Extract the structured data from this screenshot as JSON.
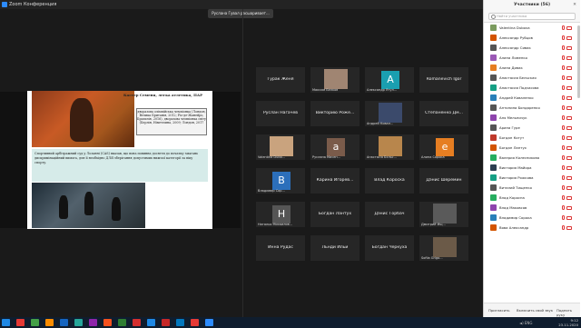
{
  "window": {
    "title": "Zoom Конференция",
    "share_banner": "Руслана Гувал расшаривает..."
  },
  "slide": {
    "header": "Кастер Семеня, легка атлетика, ПАР",
    "box1": "дворазова олімпійська чемпіонка (Лондон, Велика Британія, 2012; Ріо-де-Жанейро, Бразилія, 2016), дворазова чемпіонка світу (Берлін, Німеччина, 2009; Лондон, 2017",
    "box2": "Спортивний арбітражний суд у Лозанні (CAS) вказав, що вона повинна досягти до початку змагань дискримінаційний вимога, для її необхідно ДЛЯ зберігання допустимих нижчої категорії за віку спорту."
  },
  "tiles": [
    {
      "name": "Гурак Женя",
      "cap": "",
      "avatar": null
    },
    {
      "name": "",
      "cap": "Максим Белков",
      "avatar": "photo"
    },
    {
      "name": "",
      "cap": "Александр Ятул...",
      "avatar": "A",
      "color": "#1a9fb0"
    },
    {
      "name": "Romanevich Igor",
      "cap": "",
      "avatar": null
    },
    {
      "name": "Руслан Нагачев",
      "cap": "",
      "avatar": null
    },
    {
      "name": "Викторию Роже...",
      "cap": "",
      "avatar": null
    },
    {
      "name": "",
      "cap": "Андрей Ковал...",
      "avatar": "photo2"
    },
    {
      "name": "Степаненко Дм...",
      "cap": "",
      "avatar": null
    },
    {
      "name": "",
      "cap": "Valentina Dubo...",
      "avatar": "photo3"
    },
    {
      "name": "",
      "cap": "Руслана Мисен...",
      "avatar": "a",
      "color": "#7a5b4a"
    },
    {
      "name": "",
      "cap": "Анастасія Бєльс...",
      "avatar": "photo4"
    },
    {
      "name": "",
      "cap": "Алина Сорока",
      "avatar": "e",
      "color": "#e67e22"
    },
    {
      "name": "",
      "cap": "Владимир Сор...",
      "avatar": "B",
      "color": "#2c6fbb"
    },
    {
      "name": "Карина Игорев...",
      "cap": "",
      "avatar": null
    },
    {
      "name": "Влад Короска",
      "cap": "",
      "avatar": null
    },
    {
      "name": "Дэнис Шеремин",
      "cap": "",
      "avatar": null
    },
    {
      "name": "",
      "cap": "Наталья Михаилов...",
      "avatar": "H",
      "color": "#555"
    },
    {
      "name": "Богдан Лантух",
      "cap": "",
      "avatar": null
    },
    {
      "name": "Дэнис Горбач",
      "cap": "",
      "avatar": null
    },
    {
      "name": "",
      "cap": "Дмитрий Ищ...",
      "avatar": "photo5"
    },
    {
      "name": "Инна Рудас",
      "cap": "",
      "avatar": null
    },
    {
      "name": "Льнди Ильи",
      "cap": "",
      "avatar": null
    },
    {
      "name": "Богдан Черкуха",
      "cap": "",
      "avatar": null
    },
    {
      "name": "",
      "cap": "Sofiia Grigo...",
      "avatar": "photo6"
    }
  ],
  "panel": {
    "title": "Участники (56)",
    "close": "✕",
    "search_placeholder": "Найти участника",
    "participants": [
      {
        "name": "Valentina Dubova",
        "color": "#7a9a5d"
      },
      {
        "name": "Александр Рубцов",
        "color": "#d35400"
      },
      {
        "name": "Александр Сивак",
        "color": "#555"
      },
      {
        "name": "Алина Ломенко",
        "color": "#9b59b6"
      },
      {
        "name": "Алина Дивак",
        "color": "#e67e22"
      },
      {
        "name": "Анастасия Бельская",
        "color": "#555"
      },
      {
        "name": "Анастасия Подчасова",
        "color": "#16a085"
      },
      {
        "name": "Андрей Коваленко",
        "color": "#2980b9"
      },
      {
        "name": "Антонина Бондаренко",
        "color": "#555"
      },
      {
        "name": "Аня Мельничук",
        "color": "#8e44ad"
      },
      {
        "name": "Арина Гуре",
        "color": "#555"
      },
      {
        "name": "Богдан Котут",
        "color": "#c0392b"
      },
      {
        "name": "Богдан Лантух",
        "color": "#d35400"
      },
      {
        "name": "Валерия Колесникова",
        "color": "#27ae60"
      },
      {
        "name": "Виктория Майора",
        "color": "#2c3e50"
      },
      {
        "name": "Виктория Рожкова",
        "color": "#16a085"
      },
      {
        "name": "Виталий Тищенко",
        "color": "#555"
      },
      {
        "name": "Влад Коросна",
        "color": "#27ae60"
      },
      {
        "name": "Влад Маковсов",
        "color": "#8e44ad"
      },
      {
        "name": "Владимир Сорока",
        "color": "#2980b9"
      },
      {
        "name": "Вова Александр",
        "color": "#d35400"
      }
    ],
    "footer": {
      "invite": "Пригласить",
      "mute_all": "Включить свой звук",
      "raise": "Поднять руку"
    }
  },
  "taskbar": {
    "time": "9:12",
    "date": "23.11.2020",
    "tray_misc": "◄) ENG"
  }
}
